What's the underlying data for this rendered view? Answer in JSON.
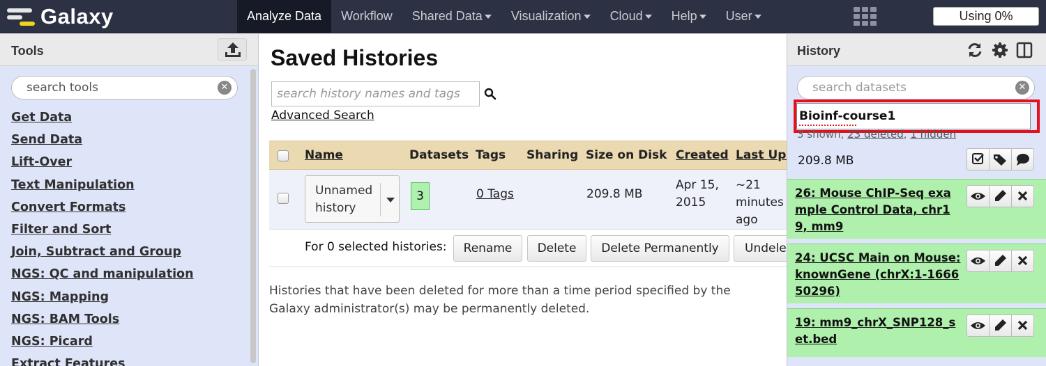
{
  "masthead": {
    "brand": "Galaxy",
    "nav": [
      {
        "label": "Analyze Data",
        "active": true,
        "dropdown": false
      },
      {
        "label": "Workflow",
        "active": false,
        "dropdown": false
      },
      {
        "label": "Shared Data",
        "active": false,
        "dropdown": true
      },
      {
        "label": "Visualization",
        "active": false,
        "dropdown": true
      },
      {
        "label": "Cloud",
        "active": false,
        "dropdown": true
      },
      {
        "label": "Help",
        "active": false,
        "dropdown": true
      },
      {
        "label": "User",
        "active": false,
        "dropdown": true
      }
    ],
    "quota": "Using 0%"
  },
  "tools": {
    "title": "Tools",
    "search_placeholder": "search tools",
    "sections": [
      "Get Data",
      "Send Data",
      "Lift-Over",
      "Text Manipulation",
      "Convert Formats",
      "Filter and Sort",
      "Join, Subtract and Group",
      "NGS: QC and manipulation",
      "NGS: Mapping",
      "NGS: BAM Tools",
      "NGS: Picard",
      "Extract Features"
    ]
  },
  "center": {
    "title": "Saved Histories",
    "search_placeholder": "search history names and tags",
    "advanced_search": "Advanced Search",
    "columns": {
      "name": "Name",
      "datasets": "Datasets",
      "tags": "Tags",
      "sharing": "Sharing",
      "size": "Size on Disk",
      "created": "Created",
      "updated": "Last Updated"
    },
    "rows": [
      {
        "name": "Unnamed history",
        "datasets": "3",
        "tags": "0 Tags",
        "sharing": "",
        "size": "209.8 MB",
        "created": "Apr 15, 2015",
        "updated": "~21 minutes ago"
      }
    ],
    "bulk_label": "For 0 selected histories:",
    "bulk_buttons": [
      "Rename",
      "Delete",
      "Delete Permanently",
      "Undelete"
    ],
    "note": "Histories that have been deleted for more than a time period specified by the Galaxy administrator(s) may be permanently deleted."
  },
  "history": {
    "title": "History",
    "search_placeholder": "search datasets",
    "name": "Bioinf-course1",
    "summary": {
      "shown": "3 shown, ",
      "deleted": "23 deleted",
      "sep": ", ",
      "hidden": "1 hidden"
    },
    "size": "209.8 MB",
    "datasets": [
      {
        "title": "26: Mouse ChIP-Seq example Control Data, chr19, mm9",
        "state_color": "#aef0ac"
      },
      {
        "title": "24: UCSC Main on Mouse: knownGene (chrX:1-166650296)",
        "state_color": "#aef0ac"
      },
      {
        "title": "19: mm9_chrX_SNP128_set.bed",
        "state_color": "#aef0ac"
      }
    ]
  },
  "colors": {
    "masthead": "#2c3143",
    "panel_bg": "#dfe5f9",
    "table_header": "#ebd9b2",
    "dataset_ok": "#aef0ac",
    "highlight": "#e3101f"
  }
}
